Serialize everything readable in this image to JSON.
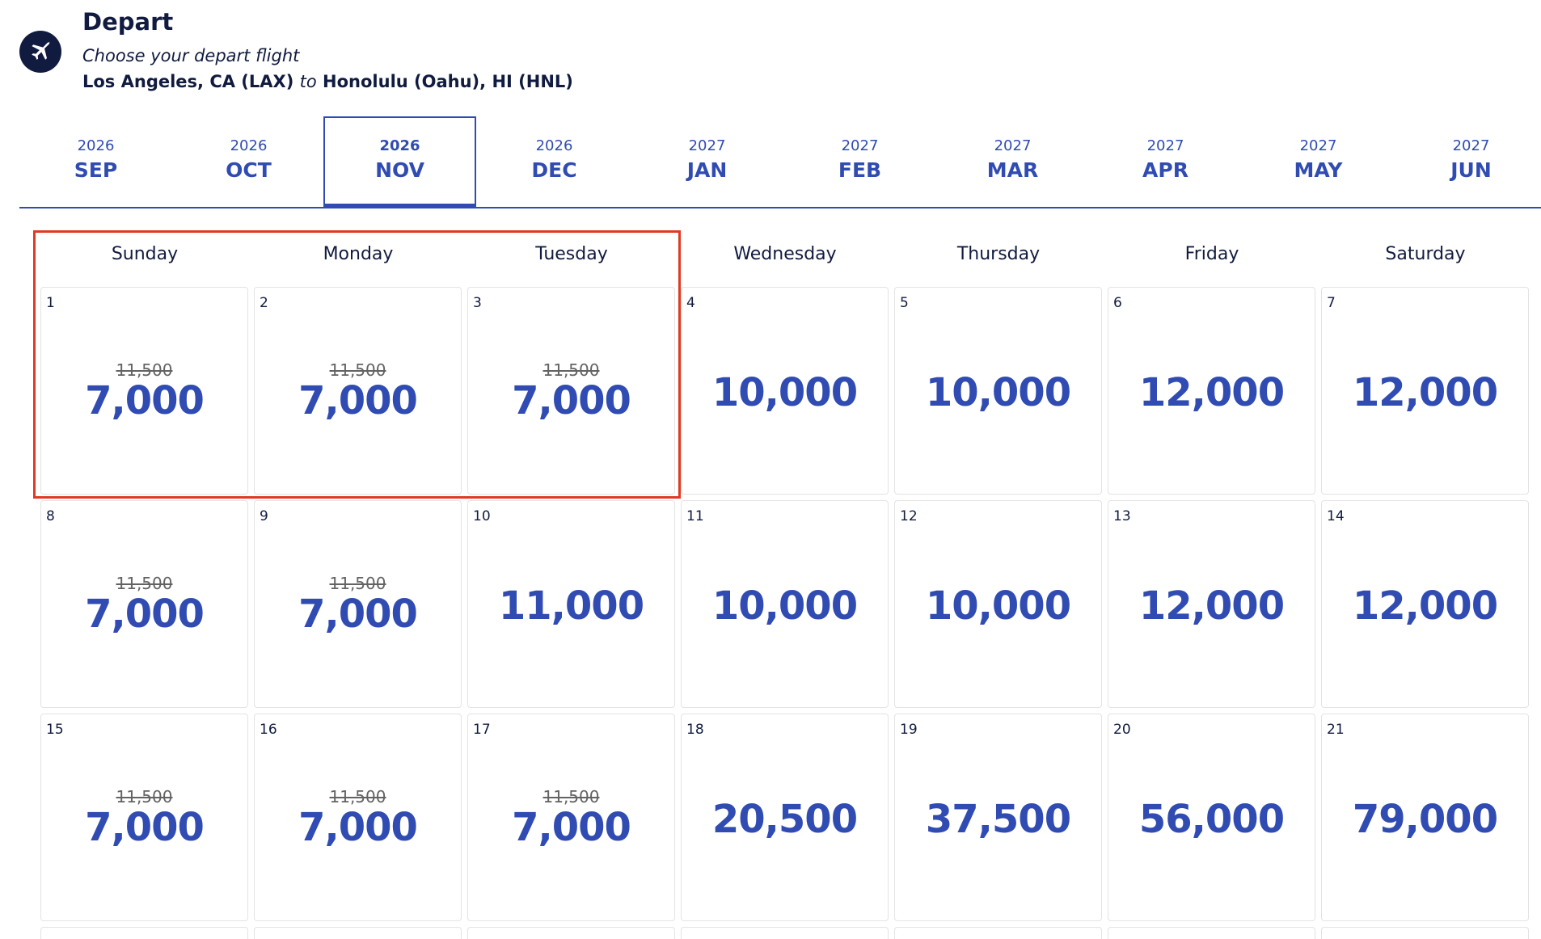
{
  "header": {
    "title": "Depart",
    "subtitle": "Choose your depart flight",
    "origin": "Los Angeles, CA (LAX)",
    "connector": "to",
    "destination": "Honolulu (Oahu), HI (HNL)",
    "icon": "airplane-icon"
  },
  "months": [
    {
      "year": "2026",
      "month": "SEP",
      "active": false
    },
    {
      "year": "2026",
      "month": "OCT",
      "active": false
    },
    {
      "year": "2026",
      "month": "NOV",
      "active": true
    },
    {
      "year": "2026",
      "month": "DEC",
      "active": false
    },
    {
      "year": "2027",
      "month": "JAN",
      "active": false
    },
    {
      "year": "2027",
      "month": "FEB",
      "active": false
    },
    {
      "year": "2027",
      "month": "MAR",
      "active": false
    },
    {
      "year": "2027",
      "month": "APR",
      "active": false
    },
    {
      "year": "2027",
      "month": "MAY",
      "active": false
    },
    {
      "year": "2027",
      "month": "JUN",
      "active": false
    }
  ],
  "weekdays": [
    "Sunday",
    "Monday",
    "Tuesday",
    "Wednesday",
    "Thursday",
    "Friday",
    "Saturday"
  ],
  "days": [
    {
      "day": "1",
      "old": "11,500",
      "price": "7,000"
    },
    {
      "day": "2",
      "old": "11,500",
      "price": "7,000"
    },
    {
      "day": "3",
      "old": "11,500",
      "price": "7,000"
    },
    {
      "day": "4",
      "old": "",
      "price": "10,000"
    },
    {
      "day": "5",
      "old": "",
      "price": "10,000"
    },
    {
      "day": "6",
      "old": "",
      "price": "12,000"
    },
    {
      "day": "7",
      "old": "",
      "price": "12,000"
    },
    {
      "day": "8",
      "old": "11,500",
      "price": "7,000"
    },
    {
      "day": "9",
      "old": "11,500",
      "price": "7,000"
    },
    {
      "day": "10",
      "old": "",
      "price": "11,000"
    },
    {
      "day": "11",
      "old": "",
      "price": "10,000"
    },
    {
      "day": "12",
      "old": "",
      "price": "10,000"
    },
    {
      "day": "13",
      "old": "",
      "price": "12,000"
    },
    {
      "day": "14",
      "old": "",
      "price": "12,000"
    },
    {
      "day": "15",
      "old": "11,500",
      "price": "7,000"
    },
    {
      "day": "16",
      "old": "11,500",
      "price": "7,000"
    },
    {
      "day": "17",
      "old": "11,500",
      "price": "7,000"
    },
    {
      "day": "18",
      "old": "",
      "price": "20,500"
    },
    {
      "day": "19",
      "old": "",
      "price": "37,500"
    },
    {
      "day": "20",
      "old": "",
      "price": "56,000"
    },
    {
      "day": "21",
      "old": "",
      "price": "79,000"
    }
  ],
  "colors": {
    "brand_blue": "#304cb2",
    "navy": "#111b40",
    "annotation_red": "#e13a24"
  }
}
